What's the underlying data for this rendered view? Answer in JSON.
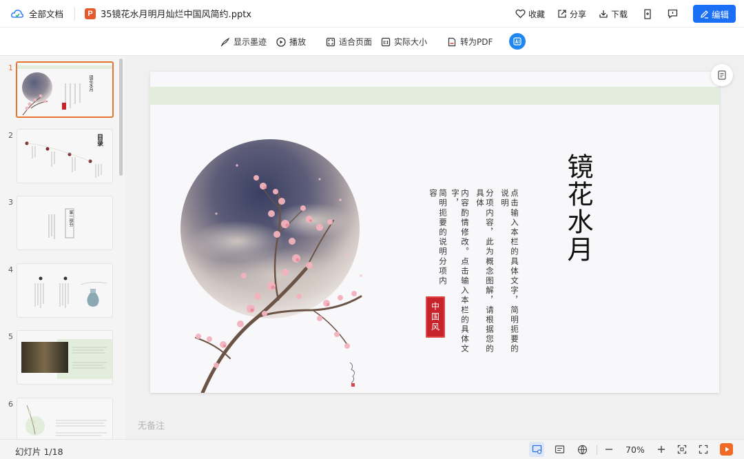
{
  "topbar": {
    "all_docs": "全部文档",
    "file_badge": "P",
    "filename": "35镜花水月明月灿烂中国风简约.pptx",
    "favorite": "收藏",
    "share": "分享",
    "download": "下载",
    "edit": "编辑"
  },
  "toolbar": {
    "show_ink": "显示墨迹",
    "play": "播放",
    "fit_page": "适合页面",
    "actual_size": "实际大小",
    "to_pdf": "转为PDF"
  },
  "thumbnails": [
    {
      "num": "1"
    },
    {
      "num": "2"
    },
    {
      "num": "3"
    },
    {
      "num": "4"
    },
    {
      "num": "5"
    },
    {
      "num": "6"
    }
  ],
  "thumb_text": {
    "t1_title": "镜花水月",
    "t2_title": "目录",
    "t3_title": "第一部分"
  },
  "slide": {
    "title": "镜花水月",
    "col1": "点击输入本栏的具体文字，简明扼要的说明",
    "col2": "分项内容，此为概念图解，请根据您的具体",
    "col3": "内容酌情修改。点击输入本栏的具体文字，",
    "col4": "简明扼要的说明分项内容",
    "seal": "中国风"
  },
  "note": "无备注",
  "status": {
    "slide_count": "幻灯片 1/18",
    "zoom": "70%"
  },
  "colors": {
    "accent": "#1a6ff5",
    "active_thumb": "#e5752f",
    "seal_red": "#c8232c",
    "band_green": "#e3eddc"
  }
}
